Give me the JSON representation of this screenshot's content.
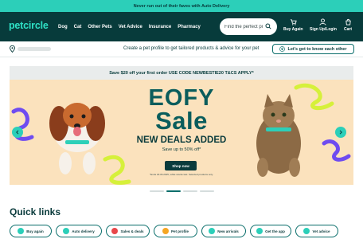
{
  "promo": {
    "text": "Never run out of their faves with Auto Delivery"
  },
  "nav": {
    "logo": "petcircle",
    "links": [
      "Dog",
      "Cat",
      "Other Pets",
      "Vet Advice",
      "Insurance",
      "Pharmacy"
    ],
    "search": {
      "placeholder": "Find the perfect product",
      "icon": "search-icon"
    },
    "actions": [
      {
        "label": "Buy Again",
        "icon": "buy-again-icon"
      },
      {
        "label": "Sign Up/Login",
        "icon": "user-icon"
      },
      {
        "label": "Cart",
        "icon": "cart-icon"
      }
    ]
  },
  "subbar": {
    "profile_text": "Create a pet profile to get tailored products & advice for your pet",
    "profile_button": "Let's get to know each other"
  },
  "banner": {
    "offer": "Save $20 off your first order USE CODE NEWBESTIE20 T&CS APPLY*",
    "title_line1": "EOFY",
    "title_line2": "Sale",
    "subtitle": "NEW DEALS ADDED",
    "save_text": "Save up to 50% off*",
    "button": "Shop now",
    "terms": "*Ends 29.06.2025, while stocks last. Selected products only.",
    "slides": 4,
    "active_slide": 1
  },
  "quick_links": {
    "title": "Quick links",
    "items": [
      {
        "label": "Buy again",
        "color": "#2ccfb9"
      },
      {
        "label": "Auto delivery",
        "color": "#2ccfb9"
      },
      {
        "label": "Sales & deals",
        "color": "#e8474a"
      },
      {
        "label": "Pet profile",
        "color": "#f5a623"
      },
      {
        "label": "New arrivals",
        "color": "#2ccfb9"
      },
      {
        "label": "Get the app",
        "color": "#2ccfb9"
      },
      {
        "label": "Vet advice",
        "color": "#2ccfb9"
      }
    ]
  },
  "colors": {
    "brand_dark": "#073b3b",
    "brand_teal": "#2ccfb9",
    "hero_bg": "#fbe2bd"
  }
}
